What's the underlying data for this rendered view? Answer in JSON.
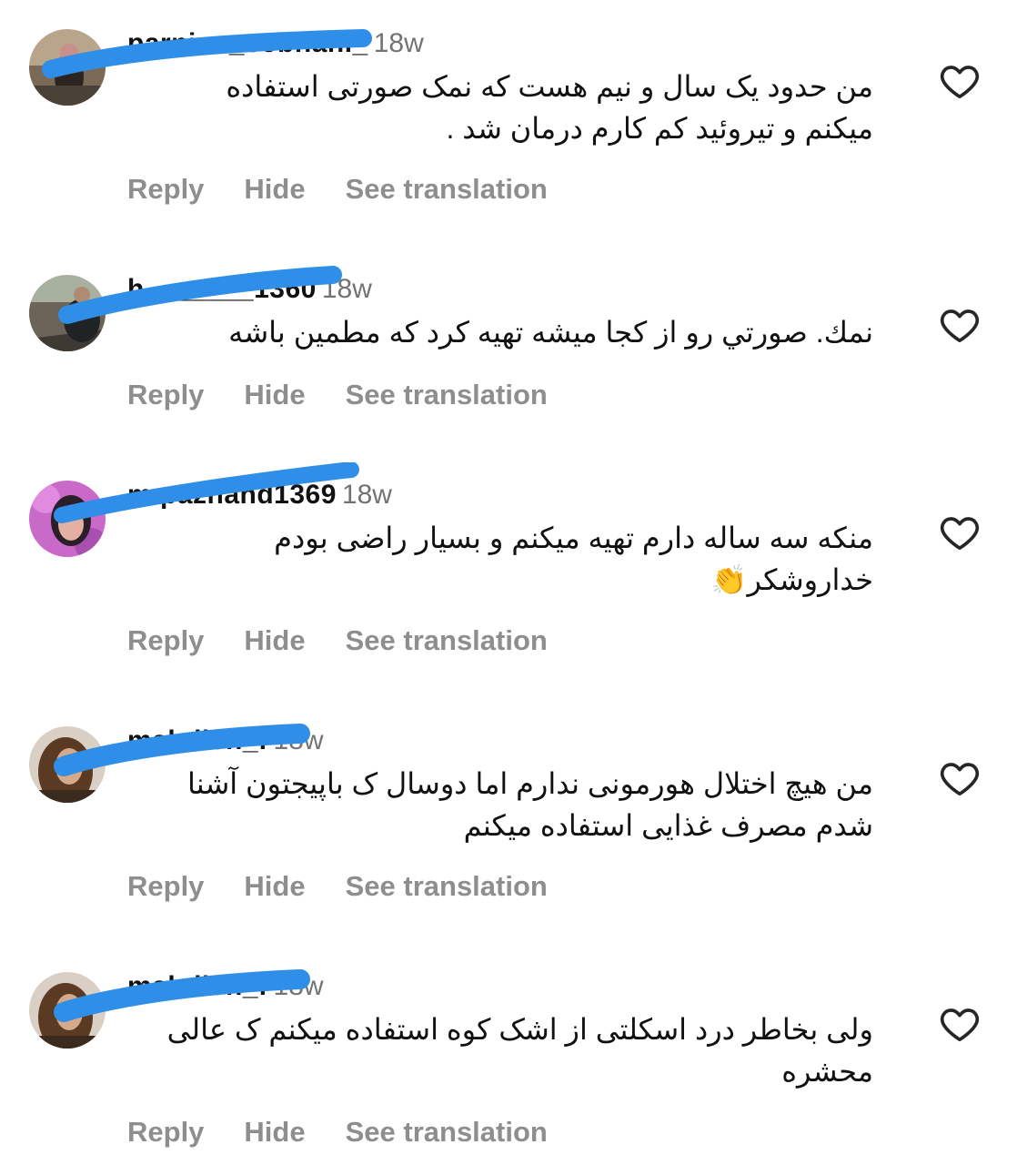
{
  "comments": [
    {
      "username": "parnian_sobhani_",
      "time": "18w",
      "lines": [
        "من حدود یک سال و نیم هست که نمک صورتی استفاده",
        "میکنم و تیروئید کم کارم درمان شد ."
      ],
      "reply": "Reply",
      "hide": "Hide",
      "translate": "See translation"
    },
    {
      "username": "h_______1360",
      "time": "18w",
      "lines": [
        "نمك. صورتي رو از كجا ميشه تهيه كرد  که مطمین باشه"
      ],
      "reply": "Reply",
      "hide": "Hide",
      "translate": "See translation"
    },
    {
      "username": "m.pazhand1369",
      "time": "18w",
      "lines": [
        "منکه سه ساله دارم تهیه میکنم و بسیار راضی بودم",
        "خداروشکر👏"
      ],
      "reply": "Reply",
      "hide": "Hide",
      "translate": "See translation"
    },
    {
      "username": "mahdieh_f",
      "time": "18w",
      "lines": [
        "من هیچ اختلال هورمونی ندارم اما دوسال ک باپیجتون آشنا",
        "شدم مصرف غذایی استفاده میکنم"
      ],
      "reply": "Reply",
      "hide": "Hide",
      "translate": "See translation"
    },
    {
      "username": "mahdieh_f",
      "time": "18w",
      "lines": [
        "ولی بخاطر درد اسکلتی از اشک کوه استفاده میکنم ک عالی",
        "محشره"
      ],
      "reply": "Reply",
      "hide": "Hide",
      "translate": "See translation"
    }
  ],
  "colors": {
    "redaction": "#2f8fe8",
    "action_text": "#8e8e8e",
    "timestamp": "#737373",
    "heart_outline": "#262626"
  },
  "icons": {
    "like": "heart-outline-icon"
  }
}
